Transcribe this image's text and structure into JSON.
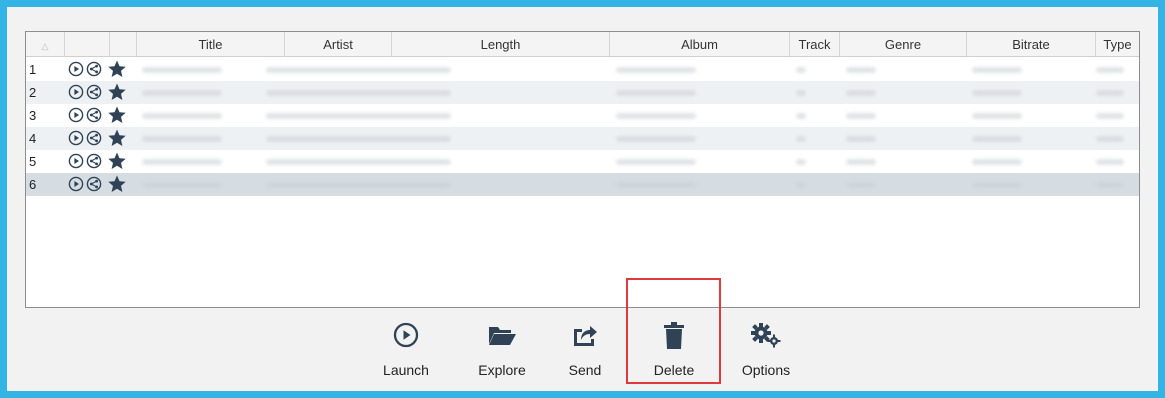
{
  "table": {
    "columns": [
      {
        "key": "sort",
        "label": "",
        "icon": "sort-indicator-icon"
      },
      {
        "key": "actions",
        "label": ""
      },
      {
        "key": "fav",
        "label": ""
      },
      {
        "key": "title",
        "label": "Title"
      },
      {
        "key": "artist",
        "label": "Artist"
      },
      {
        "key": "length",
        "label": "Length"
      },
      {
        "key": "album",
        "label": "Album"
      },
      {
        "key": "track",
        "label": "Track"
      },
      {
        "key": "genre",
        "label": "Genre"
      },
      {
        "key": "bitrate",
        "label": "Bitrate"
      },
      {
        "key": "type",
        "label": "Type"
      }
    ],
    "rows": [
      {
        "num": "1",
        "selected": false
      },
      {
        "num": "2",
        "selected": false
      },
      {
        "num": "3",
        "selected": false
      },
      {
        "num": "4",
        "selected": false
      },
      {
        "num": "5",
        "selected": false
      },
      {
        "num": "6",
        "selected": true
      }
    ]
  },
  "toolbar": {
    "launch_label": "Launch",
    "explore_label": "Explore",
    "send_label": "Send",
    "delete_label": "Delete",
    "options_label": "Options"
  },
  "colors": {
    "frame": "#34b4e4",
    "icon": "#3a4f63",
    "highlight": "#e0393d",
    "selected_row": "#d5dde3"
  }
}
